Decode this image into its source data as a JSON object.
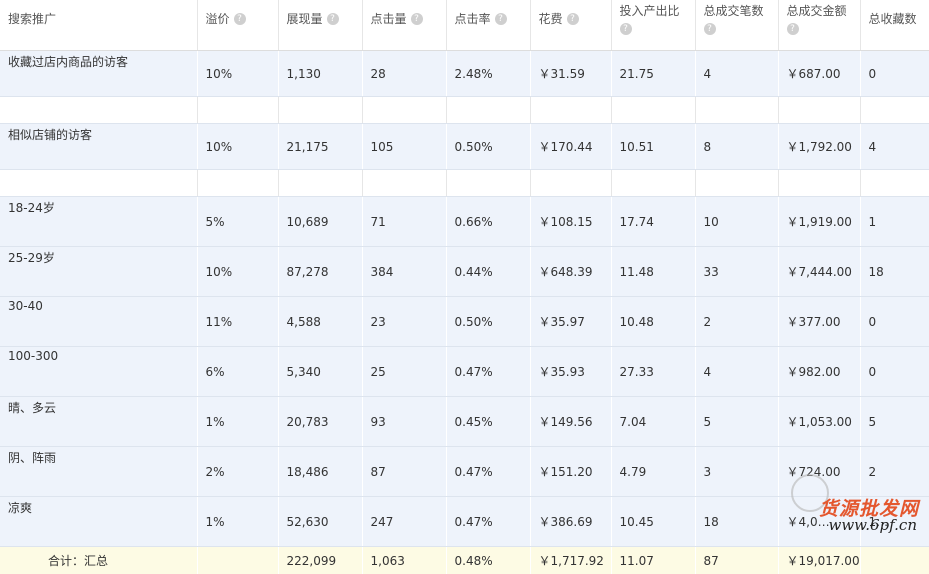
{
  "headers": [
    {
      "label": "搜索推广",
      "help": false
    },
    {
      "label": "溢价",
      "help": true
    },
    {
      "label": "展现量",
      "help": true
    },
    {
      "label": "点击量",
      "help": true
    },
    {
      "label": "点击率",
      "help": true
    },
    {
      "label": "花费",
      "help": true
    },
    {
      "label": "投入产出比",
      "help": true
    },
    {
      "label": "总成交笔数",
      "help": true
    },
    {
      "label": "总成交金额",
      "help": true
    },
    {
      "label": "总收藏数",
      "help": false
    }
  ],
  "rows": [
    {
      "name": "收藏过店内商品的访客",
      "cells": [
        "10%",
        "1,130",
        "28",
        "2.48%",
        "￥31.59",
        "21.75",
        "4",
        "￥687.00",
        "0"
      ]
    },
    {
      "spacer": true
    },
    {
      "name": "相似店铺的访客",
      "cells": [
        "10%",
        "21,175",
        "105",
        "0.50%",
        "￥170.44",
        "10.51",
        "8",
        "￥1,792.00",
        "4"
      ]
    },
    {
      "spacer": true
    },
    {
      "name": "18-24岁",
      "cells": [
        "5%",
        "10,689",
        "71",
        "0.66%",
        "￥108.15",
        "17.74",
        "10",
        "￥1,919.00",
        "1"
      ]
    },
    {
      "name": "25-29岁",
      "cells": [
        "10%",
        "87,278",
        "384",
        "0.44%",
        "￥648.39",
        "11.48",
        "33",
        "￥7,444.00",
        "18"
      ]
    },
    {
      "name": "30-40",
      "cells": [
        "11%",
        "4,588",
        "23",
        "0.50%",
        "￥35.97",
        "10.48",
        "2",
        "￥377.00",
        "0"
      ]
    },
    {
      "name": "100-300",
      "cells": [
        "6%",
        "5,340",
        "25",
        "0.47%",
        "￥35.93",
        "27.33",
        "4",
        "￥982.00",
        "0"
      ]
    },
    {
      "name": "晴、多云",
      "cells": [
        "1%",
        "20,783",
        "93",
        "0.45%",
        "￥149.56",
        "7.04",
        "5",
        "￥1,053.00",
        "5"
      ]
    },
    {
      "name": "阴、阵雨",
      "cells": [
        "2%",
        "18,486",
        "87",
        "0.47%",
        "￥151.20",
        "4.79",
        "3",
        "￥724.00",
        "2"
      ]
    },
    {
      "name": "凉爽",
      "cells": [
        "1%",
        "52,630",
        "247",
        "0.47%",
        "￥386.69",
        "10.45",
        "18",
        "￥4,0…",
        "1…"
      ]
    }
  ],
  "summary": {
    "label": "合计：汇总",
    "cells": [
      "",
      "222,099",
      "1,063",
      "0.48%",
      "￥1,717.92",
      "11.07",
      "87",
      "￥19,017.00",
      ""
    ]
  },
  "watermark": {
    "cn": "货源批发网",
    "url": "www.6pf.cn"
  }
}
